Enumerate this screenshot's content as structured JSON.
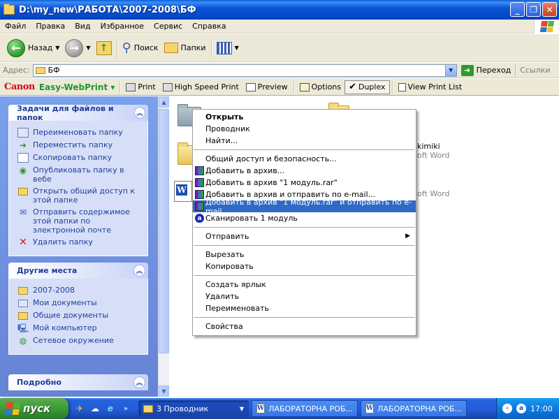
{
  "window": {
    "title": "D:\\my_new\\РАБОТА\\2007-2008\\БФ",
    "minimize": "_",
    "maximize": "❐",
    "close": "✕"
  },
  "menu": [
    "Файл",
    "Правка",
    "Вид",
    "Избранное",
    "Сервис",
    "Справка"
  ],
  "toolbar": {
    "back_label": "Назад",
    "search_label": "Поиск",
    "folders_label": "Папки"
  },
  "address": {
    "label": "Адрес:",
    "value": "БФ",
    "go_label": "Переход",
    "links_label": "Ссылки"
  },
  "canon": {
    "brand": "Canon",
    "product": "Easy-WebPrint",
    "print": "Print",
    "high_speed": "High Speed Print",
    "preview": "Preview",
    "options": "Options",
    "duplex": "Duplex",
    "view_list": "View Print List"
  },
  "tasks_panel": {
    "title": "Задачи для файлов и папок",
    "items": [
      "Переименовать папку",
      "Переместить папку",
      "Скопировать папку",
      "Опубликовать папку в вебе",
      "Открыть общий доступ к этой папке",
      "Отправить содержимое этой папки по электронной почте",
      "Удалить папку"
    ]
  },
  "places_panel": {
    "title": "Другие места",
    "items": [
      "2007-2008",
      "Мои документы",
      "Общие документы",
      "Мой компьютер",
      "Сетевое окружение"
    ]
  },
  "details_panel": {
    "title": "Подробно"
  },
  "background_files": {
    "item1_text": "kimiki",
    "item1_sub": "oft Word",
    "item2_sub": "oft Word"
  },
  "context_menu": {
    "open": "Открыть",
    "explorer": "Проводник",
    "find": "Найти...",
    "sharing": "Общий доступ и безопасность...",
    "add_archive": "Добавить в архив...",
    "add_rar": "Добавить в архив \"1 модуль.rar\"",
    "add_email": "Добавить в архив и отправить по e-mail...",
    "add_rar_email": "Добавить в архив \"1 модуль.rar\" и отправить по e-mail",
    "scan": "Сканировать 1 модуль",
    "send_to": "Отправить",
    "cut": "Вырезать",
    "copy": "Копировать",
    "shortcut": "Создать ярлык",
    "delete": "Удалить",
    "rename": "Переименовать",
    "properties": "Свойства"
  },
  "taskbar": {
    "start": "пуск",
    "task1": "3 Проводник",
    "task2": "ЛАБОРАТОРНА РОБ...",
    "task3": "ЛАБОРАТОРНА РОБ...",
    "clock": "17:00"
  },
  "colors": {
    "titlebar": "#0a54d6",
    "menu_highlight": "#316ac5",
    "taskpane": "#6683d6",
    "link": "#1f3e9b"
  }
}
